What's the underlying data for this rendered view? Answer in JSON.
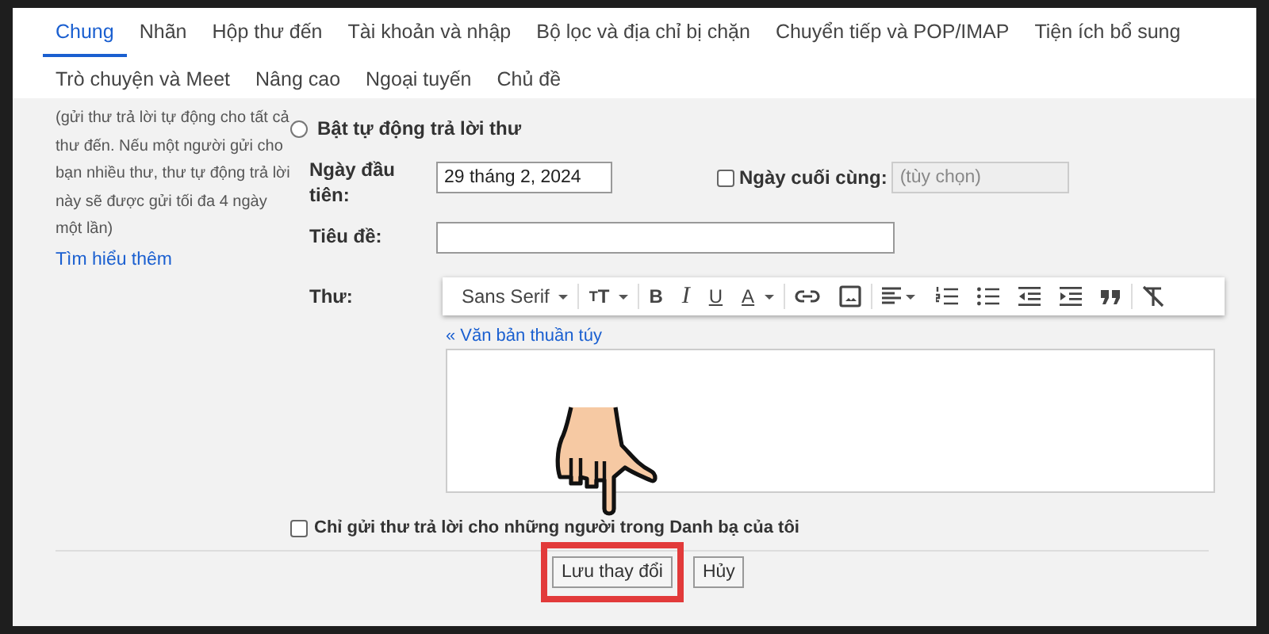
{
  "tab_rows": [
    [
      {
        "label": "Chung",
        "selected": true
      },
      {
        "label": "Nhãn",
        "selected": false
      },
      {
        "label": "Hộp thư đến",
        "selected": false
      },
      {
        "label": "Tài khoản và nhập",
        "selected": false
      },
      {
        "label": "Bộ lọc và địa chỉ bị chặn",
        "selected": false
      },
      {
        "label": "Chuyển tiếp và POP/IMAP",
        "selected": false
      },
      {
        "label": "Tiện ích bổ sung",
        "selected": false
      }
    ],
    [
      {
        "label": "Trò chuyện và Meet",
        "selected": false
      },
      {
        "label": "Nâng cao",
        "selected": false
      },
      {
        "label": "Ngoại tuyến",
        "selected": false
      },
      {
        "label": "Chủ đề",
        "selected": false
      }
    ]
  ],
  "auto_reply": {
    "description": "(gửi thư trả lời tự động cho tất cả thư đến. Nếu một người gửi cho bạn nhiều thư, thư tự động trả lời này sẽ được gửi tối đa 4 ngày một lần)",
    "learn_more_link": "Tìm hiểu thêm",
    "enable_radio": {
      "label": "Bật tự động trả lời thư",
      "selected": false
    },
    "first_day": {
      "label": "Ngày đầu tiên:",
      "value": "29 tháng 2, 2024"
    },
    "last_day": {
      "label": "Ngày cuối cùng:",
      "checked": false,
      "placeholder": "(tùy chọn)",
      "disabled": true
    },
    "subject": {
      "label": "Tiêu đề:"
    },
    "body": {
      "label": "Thư:",
      "plain_text_link": "« Văn bản thuần túy",
      "toolbar": [
        {
          "kind": "font",
          "label": "Sans Serif"
        },
        {
          "kind": "size",
          "label": "TT"
        },
        {
          "kind": "bold",
          "label": "B"
        },
        {
          "kind": "italic",
          "label": "I"
        },
        {
          "kind": "underline",
          "label": "U"
        },
        {
          "kind": "color",
          "label": "A"
        },
        {
          "kind": "link"
        },
        {
          "kind": "image"
        },
        {
          "kind": "align"
        },
        {
          "kind": "numbered-list"
        },
        {
          "kind": "bulleted-list"
        },
        {
          "kind": "indent-less"
        },
        {
          "kind": "indent-more"
        },
        {
          "kind": "quote"
        },
        {
          "kind": "clear-format"
        }
      ]
    },
    "contacts_only": {
      "label": "Chỉ gửi thư trả lời cho những người trong Danh bạ của tôi",
      "checked": false
    },
    "buttons": [
      {
        "label": "Lưu thay đổi",
        "highlighted": true
      },
      {
        "label": "Hủy",
        "highlighted": false
      }
    ]
  }
}
